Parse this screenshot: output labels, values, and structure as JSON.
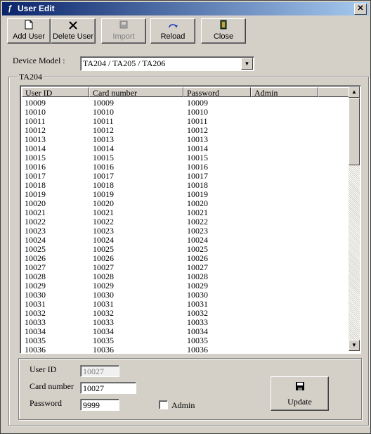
{
  "window": {
    "title": "User Edit",
    "close_glyph": "✕"
  },
  "toolbar": [
    {
      "label": "Add User",
      "icon": "new-document-icon"
    },
    {
      "label": "Delete User",
      "icon": "x-icon"
    },
    {
      "label": "Import",
      "icon": "import-icon",
      "disabled": true
    },
    {
      "label": "Reload",
      "icon": "reload-icon"
    },
    {
      "label": "Close",
      "icon": "exit-door-icon"
    }
  ],
  "device_model": {
    "label": "Device Model :",
    "value": "TA204 / TA205 / TA206"
  },
  "group_title": "TA204",
  "list": {
    "columns": [
      "User ID",
      "Card number",
      "Password",
      "Admin"
    ],
    "rows": [
      [
        "10009",
        "10009",
        "10009",
        ""
      ],
      [
        "10010",
        "10010",
        "10010",
        ""
      ],
      [
        "10011",
        "10011",
        "10011",
        ""
      ],
      [
        "10012",
        "10012",
        "10012",
        ""
      ],
      [
        "10013",
        "10013",
        "10013",
        ""
      ],
      [
        "10014",
        "10014",
        "10014",
        ""
      ],
      [
        "10015",
        "10015",
        "10015",
        ""
      ],
      [
        "10016",
        "10016",
        "10016",
        ""
      ],
      [
        "10017",
        "10017",
        "10017",
        ""
      ],
      [
        "10018",
        "10018",
        "10018",
        ""
      ],
      [
        "10019",
        "10019",
        "10019",
        ""
      ],
      [
        "10020",
        "10020",
        "10020",
        ""
      ],
      [
        "10021",
        "10021",
        "10021",
        ""
      ],
      [
        "10022",
        "10022",
        "10022",
        ""
      ],
      [
        "10023",
        "10023",
        "10023",
        ""
      ],
      [
        "10024",
        "10024",
        "10024",
        ""
      ],
      [
        "10025",
        "10025",
        "10025",
        ""
      ],
      [
        "10026",
        "10026",
        "10026",
        ""
      ],
      [
        "10027",
        "10027",
        "10027",
        ""
      ],
      [
        "10028",
        "10028",
        "10028",
        ""
      ],
      [
        "10029",
        "10029",
        "10029",
        ""
      ],
      [
        "10030",
        "10030",
        "10030",
        ""
      ],
      [
        "10031",
        "10031",
        "10031",
        ""
      ],
      [
        "10032",
        "10032",
        "10032",
        ""
      ],
      [
        "10033",
        "10033",
        "10033",
        ""
      ],
      [
        "10034",
        "10034",
        "10034",
        ""
      ],
      [
        "10035",
        "10035",
        "10035",
        ""
      ],
      [
        "10036",
        "10036",
        "10036",
        ""
      ]
    ]
  },
  "form": {
    "user_id_label": "User ID",
    "user_id_value": "10027",
    "card_number_label": "Card number",
    "card_number_value": "10027",
    "password_label": "Password",
    "password_value": "9999",
    "admin_label": "Admin",
    "admin_checked": false,
    "update_label": "Update"
  }
}
